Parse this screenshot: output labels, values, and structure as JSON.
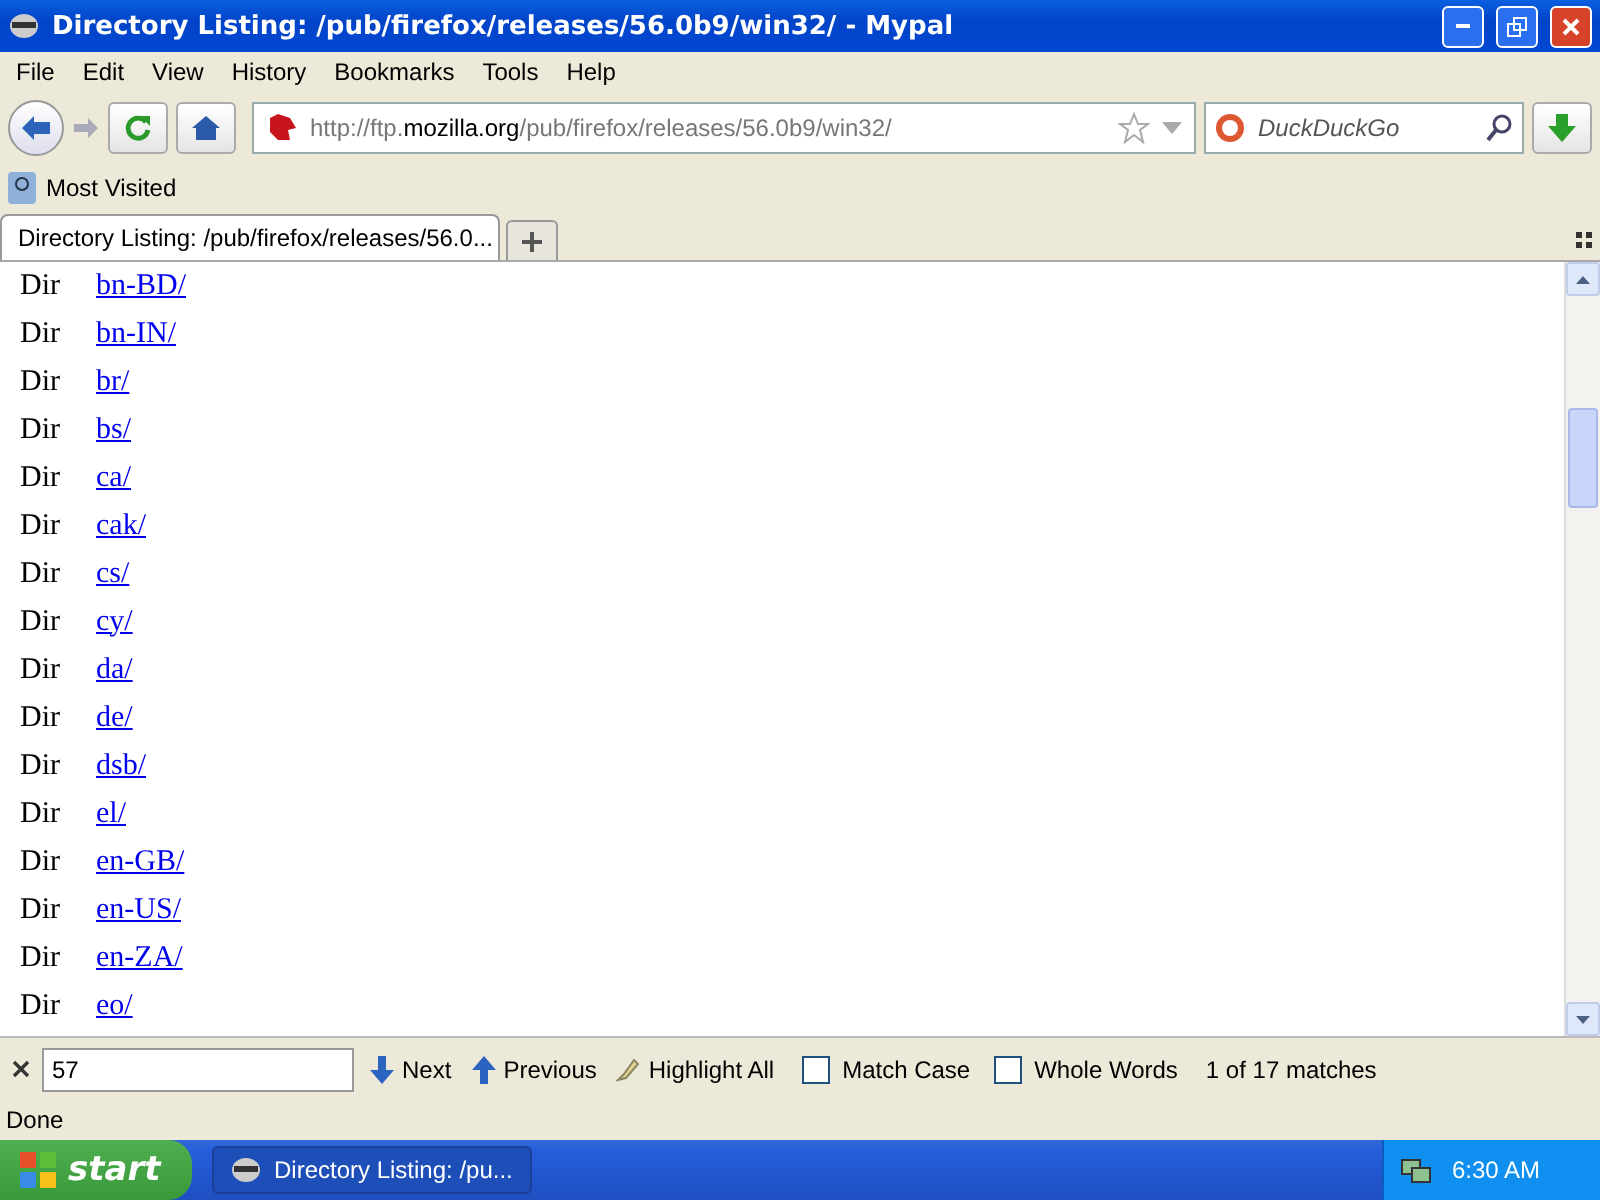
{
  "window": {
    "title": "Directory Listing: /pub/firefox/releases/56.0b9/win32/ - Mypal"
  },
  "menu": [
    "File",
    "Edit",
    "View",
    "History",
    "Bookmarks",
    "Tools",
    "Help"
  ],
  "address": {
    "scheme_host": "http://ftp.",
    "domain": "mozilla.org",
    "path": "/pub/firefox/releases/56.0b9/win32/"
  },
  "search": {
    "placeholder": "DuckDuckGo"
  },
  "bookmarks": [
    "Most Visited"
  ],
  "tabs": [
    {
      "label": "Directory Listing: /pub/firefox/releases/56.0...",
      "selected": true
    }
  ],
  "listing": [
    {
      "type": "Dir",
      "name": "bn-BD/"
    },
    {
      "type": "Dir",
      "name": "bn-IN/"
    },
    {
      "type": "Dir",
      "name": "br/"
    },
    {
      "type": "Dir",
      "name": "bs/"
    },
    {
      "type": "Dir",
      "name": "ca/"
    },
    {
      "type": "Dir",
      "name": "cak/"
    },
    {
      "type": "Dir",
      "name": "cs/"
    },
    {
      "type": "Dir",
      "name": "cy/"
    },
    {
      "type": "Dir",
      "name": "da/"
    },
    {
      "type": "Dir",
      "name": "de/"
    },
    {
      "type": "Dir",
      "name": "dsb/"
    },
    {
      "type": "Dir",
      "name": "el/"
    },
    {
      "type": "Dir",
      "name": "en-GB/"
    },
    {
      "type": "Dir",
      "name": "en-US/"
    },
    {
      "type": "Dir",
      "name": "en-ZA/"
    },
    {
      "type": "Dir",
      "name": "eo/"
    }
  ],
  "find_bar": {
    "value": "57",
    "next": "Next",
    "previous": "Previous",
    "highlight": "Highlight All",
    "options": [
      {
        "label": "Match Case",
        "checked": false
      },
      {
        "label": "Whole Words",
        "checked": false
      }
    ],
    "result": "1 of 17 matches"
  },
  "status_bar": "Done",
  "taskbar": {
    "start": "start",
    "tasks": [
      {
        "label": "Directory Listing: /pu...",
        "selected": true
      }
    ],
    "clock": "6:30 AM"
  }
}
